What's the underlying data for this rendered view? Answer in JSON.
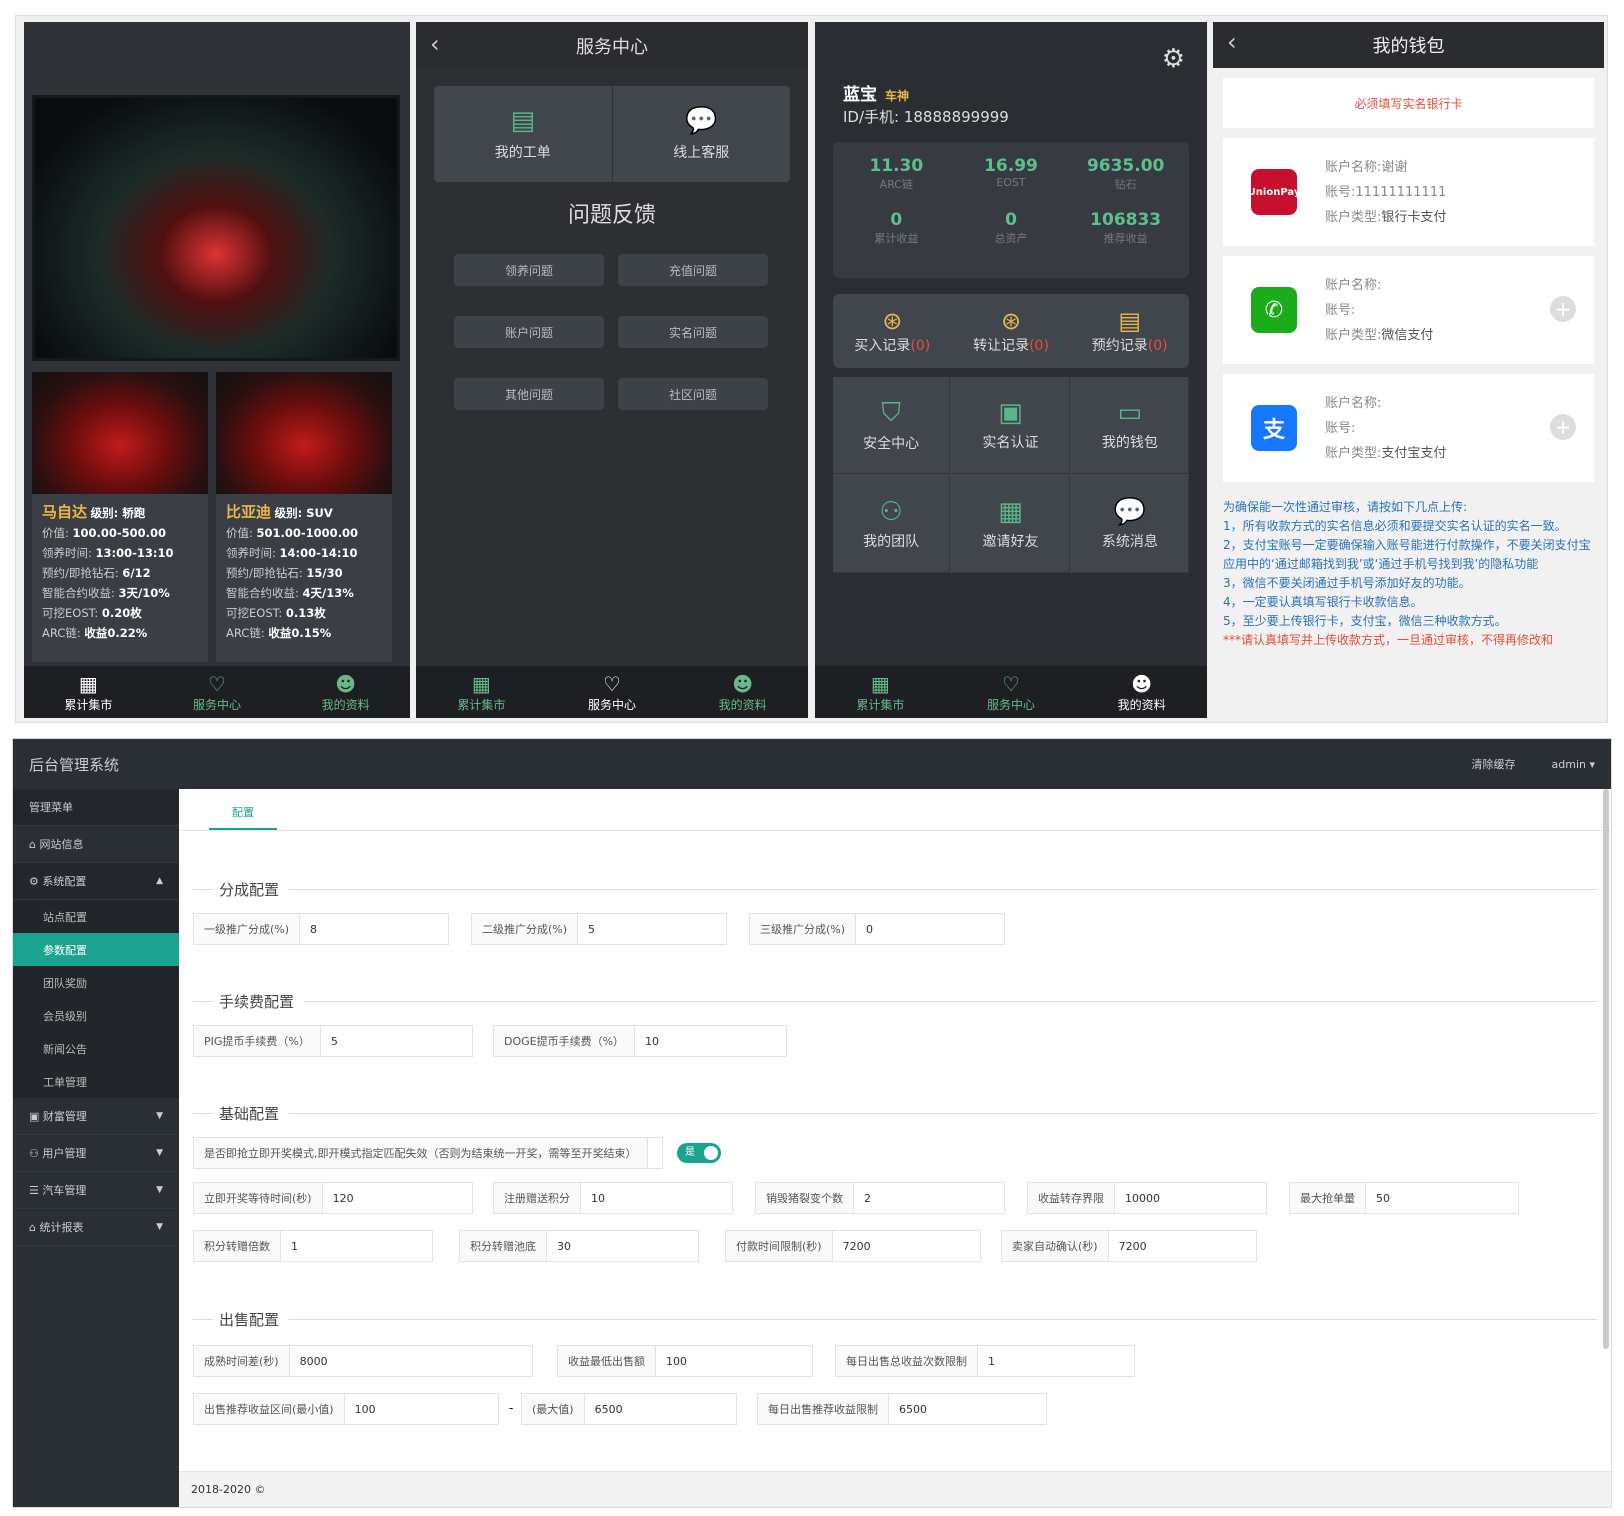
{
  "phone1": {
    "cars": [
      {
        "name": "马自达",
        "level": "级别: 轿跑",
        "price": "价值:",
        "price_v": "100.00-500.00",
        "time": "领养时间:",
        "time_v": "13:00-13:10",
        "diamond": "预约/即抢钻石:",
        "diamond_v": "6/12",
        "contract": "智能合约收益:",
        "contract_v": "3天/10%",
        "eost": "可挖EOST:",
        "eost_v": "0.20枚",
        "arc": "ARC链:",
        "arc_v": "收益0.22%"
      },
      {
        "name": "比亚迪",
        "level": "级别: SUV",
        "price": "价值:",
        "price_v": "501.00-1000.00",
        "time": "领养时间:",
        "time_v": "14:00-14:10",
        "diamond": "预约/即抢钻石:",
        "diamond_v": "15/30",
        "contract": "智能合约收益:",
        "contract_v": "4天/13%",
        "eost": "可挖EOST:",
        "eost_v": "0.13枚",
        "arc": "ARC链:",
        "arc_v": "收益0.15%"
      }
    ]
  },
  "tabs": [
    "累计集市",
    "服务中心",
    "我的资料"
  ],
  "phone2": {
    "title": "服务中心",
    "svc": [
      "我的工单",
      "线上客服"
    ],
    "feedback_title": "问题反馈",
    "feedback": [
      "领养问题",
      "充值问题",
      "账户问题",
      "实名问题",
      "其他问题",
      "社区问题"
    ]
  },
  "phone3": {
    "name": "蓝宝",
    "badge": "车神",
    "id": "ID/手机: 18888899999",
    "stats": [
      {
        "v": "11.30",
        "l": "ARC链"
      },
      {
        "v": "16.99",
        "l": "EOST"
      },
      {
        "v": "9635.00",
        "l": "钻石"
      },
      {
        "v": "0",
        "l": "累计收益"
      },
      {
        "v": "0",
        "l": "总资产"
      },
      {
        "v": "106833",
        "l": "推荐收益"
      }
    ],
    "records": [
      {
        "l": "买入记录",
        "n": "(0)"
      },
      {
        "l": "转让记录",
        "n": "(0)"
      },
      {
        "l": "预约记录",
        "n": "(0)"
      }
    ],
    "menu": [
      "安全中心",
      "实名认证",
      "我的钱包",
      "我的团队",
      "邀请好友",
      "系统消息"
    ]
  },
  "phone4": {
    "title": "我的钱包",
    "warn": "必须填写实名银行卡",
    "accounts": [
      {
        "name": "账户名称:谢谢",
        "no": "账号:11111111111",
        "type_l": "账户类型:",
        "type": "银行卡支付",
        "logo": "UnionPay",
        "color": "#c8102e"
      },
      {
        "name": "账户名称:",
        "no": "账号:",
        "type_l": "账户类型:",
        "type": "微信支付",
        "logo": "✆",
        "color": "#1aad19"
      },
      {
        "name": "账户名称:",
        "no": "账号:",
        "type_l": "账户类型:",
        "type": "支付宝支付",
        "logo": "支",
        "color": "#1677ff"
      }
    ],
    "notes": [
      "为确保能一次性通过审核，请按如下几点上传:",
      "1，所有收款方式的实名信息必须和要提交实名认证的实名一致。",
      "2，支付宝账号一定要确保输入账号能进行付款操作，不要关闭支付宝应用中的‘通过邮箱找到我’或‘通过手机号找到我’的隐私功能",
      "3，微信不要关闭通过手机号添加好友的功能。",
      "4，一定要认真填写银行卡收款信息。",
      "5，至少要上传银行卡，支付宝，微信三种收款方式。"
    ],
    "notes_red": "***请认真填写并上传收款方式，一旦通过审核，不得再修改和"
  },
  "admin": {
    "title": "后台管理系统",
    "clear": "清除缓存",
    "user": "admin ▾",
    "menu_head": "管理菜单",
    "menu": [
      "网站信息",
      "系统配置"
    ],
    "sub": [
      "站点配置",
      "参数配置",
      "团队奖励",
      "会员级别",
      "新闻公告",
      "工单管理"
    ],
    "menu2": [
      "财富管理",
      "用户管理",
      "汽车管理",
      "统计报表"
    ],
    "tab": "配置",
    "sections": [
      "分成配置",
      "手续费配置",
      "基础配置",
      "出售配置"
    ],
    "fields": {
      "f1": [
        "一级推广分成(%)",
        "8"
      ],
      "f2": [
        "二级推广分成(%)",
        "5"
      ],
      "f3": [
        "三级推广分成(%)",
        "0"
      ],
      "f4": [
        "PIG提币手续费（%）",
        "5"
      ],
      "f5": [
        "DOGE提币手续费（%）",
        "10"
      ],
      "f6": [
        "是否即抢立即开奖模式,即开模式指定匹配失效（否则为结束统一开奖，需等至开奖结束）",
        ""
      ],
      "f7": [
        "立即开奖等待时间(秒)",
        "120"
      ],
      "f8": [
        "注册赠送积分",
        "10"
      ],
      "f9": [
        "销毁猪裂变个数",
        "2"
      ],
      "f10": [
        "收益转存界限",
        "10000"
      ],
      "f11": [
        "最大抢单量",
        "50"
      ],
      "f12": [
        "积分转赠倍数",
        "1"
      ],
      "f13": [
        "积分转赠池底",
        "30"
      ],
      "f14": [
        "付款时间限制(秒)",
        "7200"
      ],
      "f15": [
        "卖家自动确认(秒)",
        "7200"
      ],
      "f16": [
        "成熟时间差(秒)",
        "8000"
      ],
      "f17": [
        "收益最低出售额",
        "100"
      ],
      "f18": [
        "每日出售总收益次数限制",
        "1"
      ],
      "f19": [
        "出售推荐收益区间(最小值)",
        "100"
      ],
      "f20": [
        "(最大值)",
        "6500"
      ],
      "f21": [
        "每日出售推荐收益限制",
        "6500"
      ]
    },
    "toggle": "是",
    "dash": "-",
    "footer": "2018-2020 ©"
  }
}
